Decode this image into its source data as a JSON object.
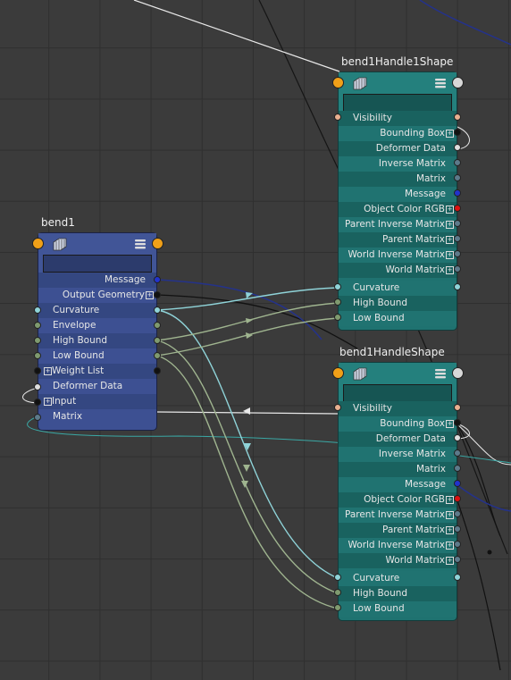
{
  "nodes": {
    "bend1": {
      "title": "bend1",
      "attributes": [
        "Message",
        "Output Geometry",
        "Curvature",
        "Envelope",
        "High Bound",
        "Low Bound",
        "Weight List",
        "Deformer Data",
        "Input",
        "Matrix"
      ]
    },
    "handle1": {
      "title": "bend1Handle1Shape",
      "attributes": [
        "Visibility",
        "Bounding Box",
        "Deformer Data",
        "Inverse Matrix",
        "Matrix",
        "Message",
        "Object Color RGB",
        "Parent Inverse Matrix",
        "Parent Matrix",
        "World Inverse Matrix",
        "World Matrix",
        "Curvature",
        "High Bound",
        "Low Bound"
      ]
    },
    "handle": {
      "title": "bend1HandleShape",
      "attributes": [
        "Visibility",
        "Bounding Box",
        "Deformer Data",
        "Inverse Matrix",
        "Matrix",
        "Message",
        "Object Color RGB",
        "Parent Inverse Matrix",
        "Parent Matrix",
        "World Inverse Matrix",
        "World Matrix",
        "Curvature",
        "High Bound",
        "Low Bound"
      ]
    }
  },
  "colors": {
    "background": "#3b3b3b",
    "deformer_node": "#3d5092",
    "shape_node": "#1f7270",
    "wire_curvature": "#8fd3d8",
    "wire_bounds": "#9fb48f",
    "wire_white": "#e8e8e8",
    "wire_black": "#111111",
    "wire_blue": "#2a3a9a",
    "plug_orange": "#f0a018",
    "plug_message": "#2233cc",
    "plug_color": "#dd1111"
  },
  "icons": [
    "geometry-icon",
    "menu-icon"
  ]
}
